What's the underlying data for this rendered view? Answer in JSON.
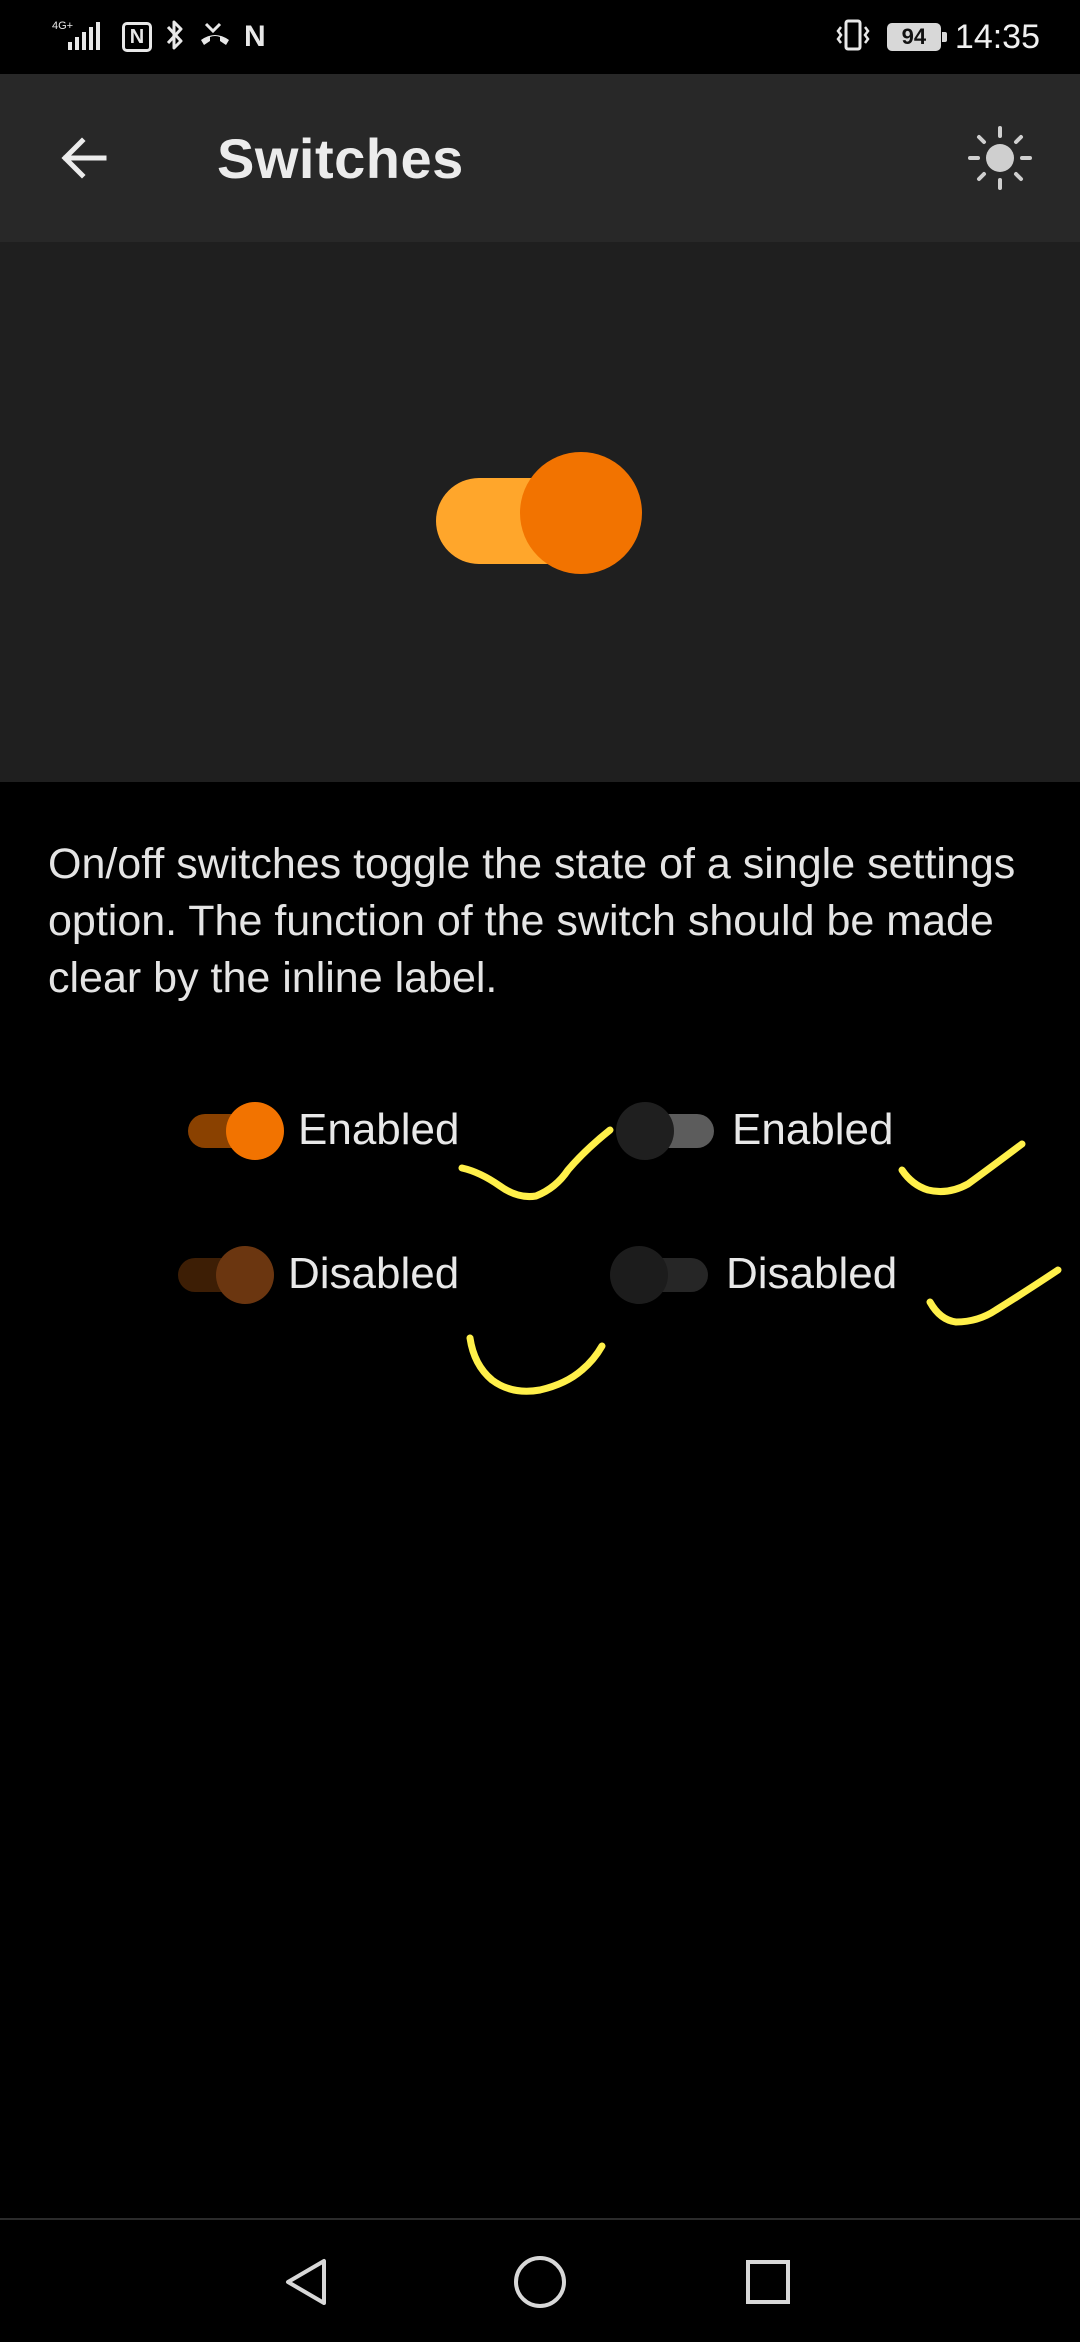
{
  "status_bar": {
    "network": "4G+",
    "nfc": "N",
    "carrier_letter": "N",
    "battery": "94",
    "time": "14:35"
  },
  "app_bar": {
    "title": "Switches",
    "back_icon": "arrow-back-icon",
    "theme_icon": "brightness-icon"
  },
  "hero": {
    "switch_state": "on"
  },
  "description": "On/off switches toggle the state of a single settings option. The function of the switch should be made clear by the inline label.",
  "switches": [
    {
      "label": "Enabled",
      "checked": true,
      "enabled": true
    },
    {
      "label": "Enabled",
      "checked": false,
      "enabled": true
    },
    {
      "label": "Disabled",
      "checked": true,
      "enabled": false
    },
    {
      "label": "Disabled",
      "checked": false,
      "enabled": false
    }
  ],
  "colors": {
    "accent": "#f27300",
    "accent_light": "#ffa62b",
    "on_track": "#8a4100",
    "on_thumb": "#f27300",
    "off_track": "#5c5c5c",
    "off_thumb": "#1f1f1f",
    "disabled_on_track": "#3d1e05",
    "disabled_on_thumb": "#6b3610",
    "disabled_off_track": "#262626",
    "disabled_off_thumb": "#1c1c1c",
    "annotation": "#fff04a"
  },
  "nav_bar": {
    "back_icon": "nav-back-icon",
    "home_icon": "nav-home-icon",
    "recents_icon": "nav-recents-icon"
  }
}
